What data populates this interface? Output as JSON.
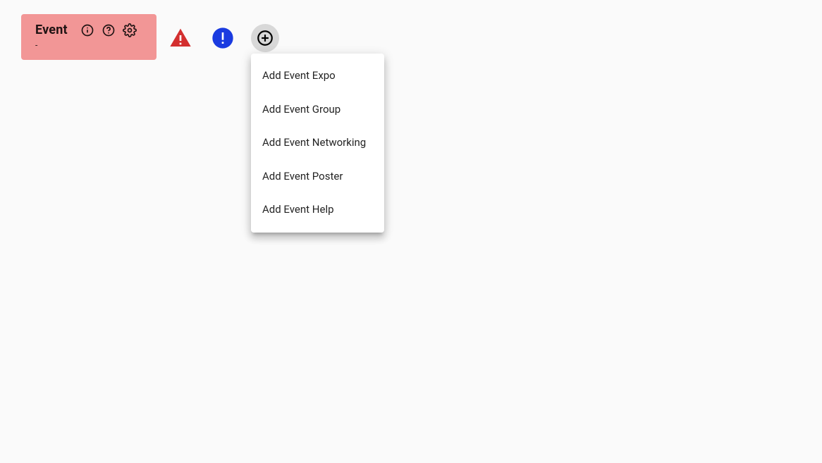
{
  "chip": {
    "title": "Event",
    "subtitle": "-"
  },
  "menu": {
    "items": [
      {
        "label": "Add Event Expo"
      },
      {
        "label": "Add Event Group"
      },
      {
        "label": "Add Event Networking"
      },
      {
        "label": "Add Event Poster"
      },
      {
        "label": "Add Event Help"
      }
    ]
  }
}
